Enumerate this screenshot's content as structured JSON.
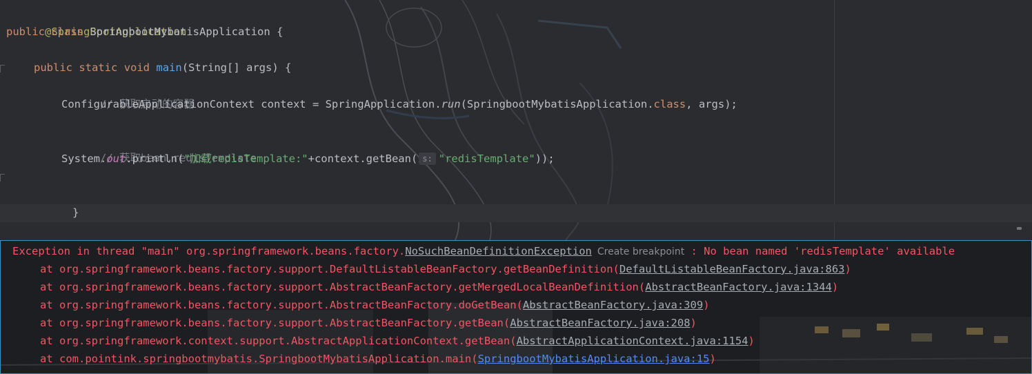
{
  "editor": {
    "annotation": "@SpringBootApplication",
    "class_decl": {
      "kw1": "public",
      "kw2": "class",
      "name": "SpringbootMybatisApplication",
      "brace": "{"
    },
    "main_decl": {
      "kw1": "public",
      "kw2": "static",
      "kw3": "void",
      "name": "main",
      "params": "(String[] args) {"
    },
    "comment1": "// 获取启动的容器",
    "line_context": {
      "part1": "ConfigurableApplicationContext context = SpringApplication.",
      "run": "run",
      "part2": "(SpringbootMybatisApplication.",
      "class_kw": "class",
      "part3": ", args);"
    },
    "comment2": "// 获取bean,redisTemplate",
    "line_println": {
      "part1": "System.",
      "out": "out",
      "part2": ".println(",
      "str1": "\"加载redisTemplate:\"",
      "part3": "+context.getBean(",
      "hint": "s:",
      "str2": "\"redisTemplate\"",
      "part4": "));"
    },
    "close_method": "}",
    "close_class": "}"
  },
  "console": {
    "exception_prefix": "Exception in thread \"main\" org.springframework.beans.factory.",
    "exception_class": "NoSuchBeanDefinitionException",
    "create_breakpoint": "Create breakpoint",
    "exception_suffix": " : No bean named 'redisTemplate' available",
    "trace": [
      {
        "prefix": "at org.springframework.beans.factory.support.DefaultListableBeanFactory.getBeanDefinition(",
        "link": "DefaultListableBeanFactory.java:863",
        "suffix": ")"
      },
      {
        "prefix": "at org.springframework.beans.factory.support.AbstractBeanFactory.getMergedLocalBeanDefinition(",
        "link": "AbstractBeanFactory.java:1344",
        "suffix": ")"
      },
      {
        "prefix": "at org.springframework.beans.factory.support.AbstractBeanFactory.doGetBean(",
        "link": "AbstractBeanFactory.java:309",
        "suffix": ")"
      },
      {
        "prefix": "at org.springframework.beans.factory.support.AbstractBeanFactory.getBean(",
        "link": "AbstractBeanFactory.java:208",
        "suffix": ")"
      },
      {
        "prefix": "at org.springframework.context.support.AbstractApplicationContext.getBean(",
        "link": "AbstractApplicationContext.java:1154",
        "suffix": ")"
      },
      {
        "prefix": "at com.pointink.springbootmybatis.SpringbootMybatisApplication.main(",
        "link": "SpringbootMybatisApplication.java:15",
        "suffix": ")"
      }
    ]
  },
  "colors": {
    "editor_bg": "#2b2c30",
    "console_bg": "#1d1e21",
    "error_text": "#f75464",
    "console_border": "#3592c4",
    "keyword": "#cf8e6d",
    "annotation": "#b3ae60",
    "string": "#6aab73",
    "method": "#56a8f5"
  }
}
